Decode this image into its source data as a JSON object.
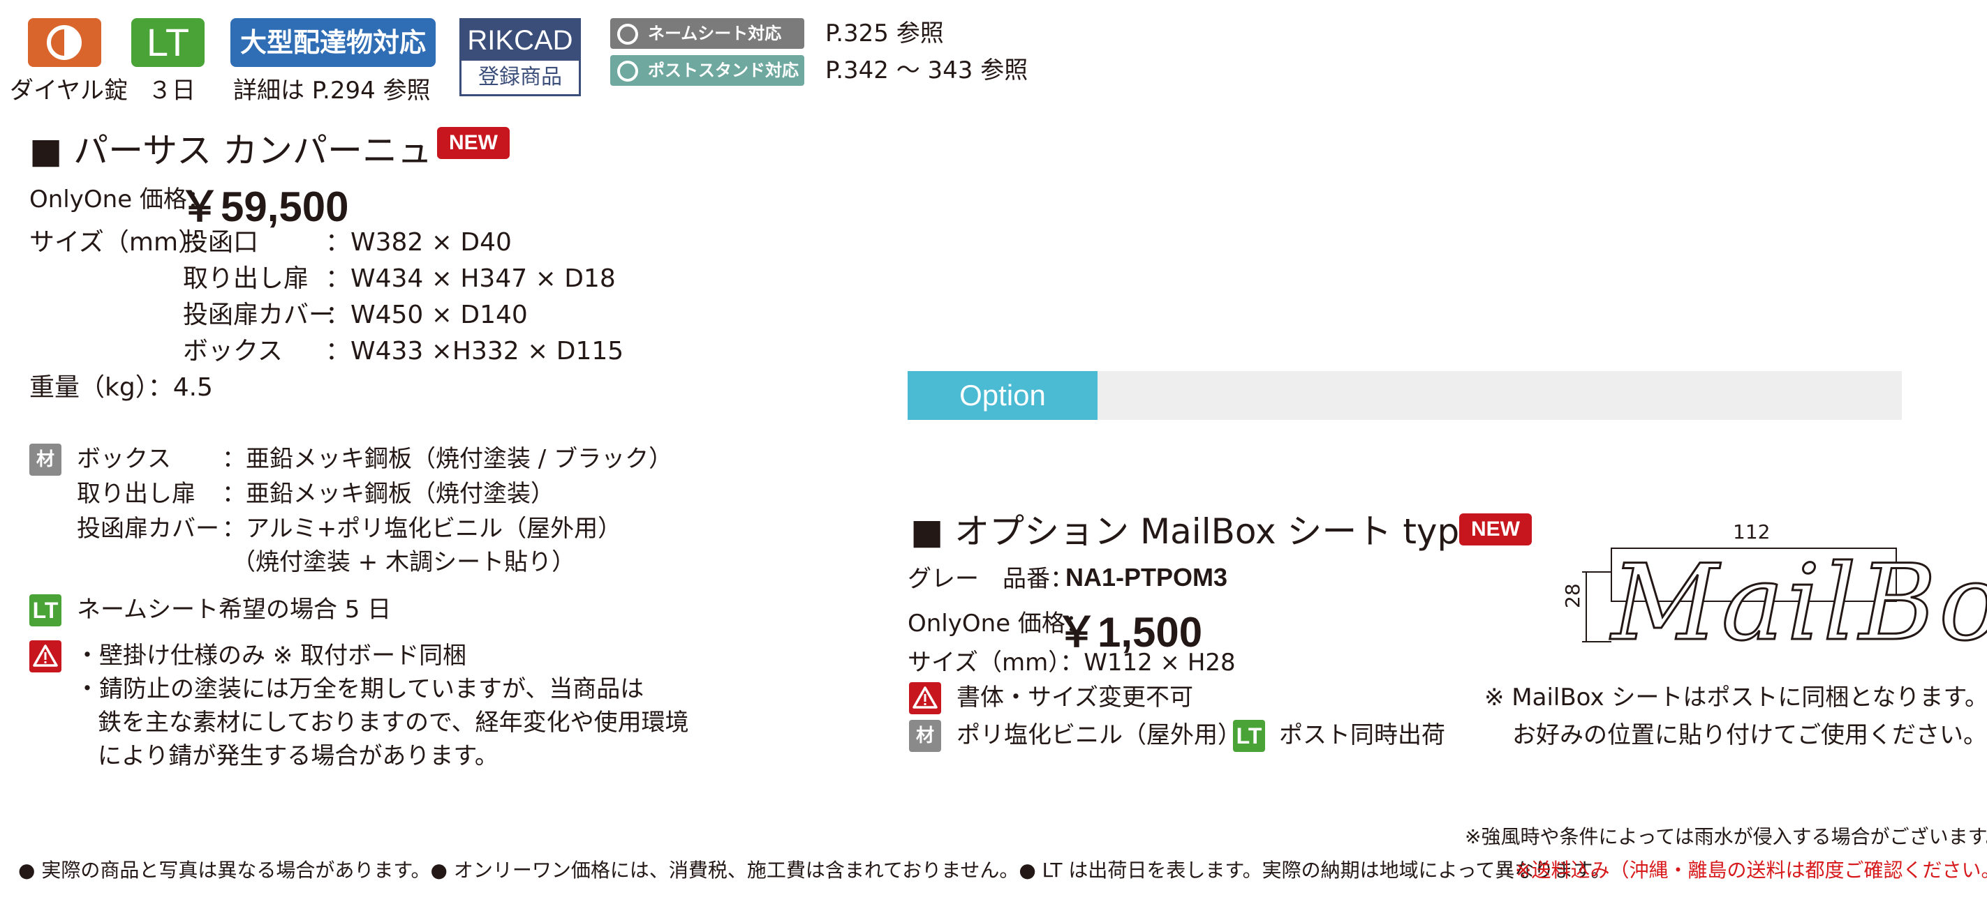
{
  "icons": {
    "dial_caption": "ダイヤル錠",
    "lt_label": "LT",
    "lt_caption": "３日",
    "large_delivery_label": "大型配達物対応",
    "large_delivery_caption": "詳細は P.294 参照",
    "rikcad_top": "RIKCAD",
    "rikcad_bottom": "登録商品"
  },
  "compat": [
    {
      "label": "ネームシート対応",
      "ref": "P.325 参照",
      "color": "#7b7b7b"
    },
    {
      "label": "ポストスタンド対応",
      "ref": "P.342 〜 343 参照",
      "color": "#6fa89e"
    }
  ],
  "product": {
    "title": "■ パーサス カンパーニュ",
    "new_badge": "NEW",
    "price_label": "OnlyOne 価格：",
    "price": "￥59,500",
    "size_label": "サイズ（mm）：",
    "sizes": [
      {
        "part": "投函口",
        "value": "：W382 × D40"
      },
      {
        "part": "取り出し扉",
        "value": "：W434 × H347 × D18"
      },
      {
        "part": "投函扉カバー",
        "value": "：W450 × D140"
      },
      {
        "part": "ボックス",
        "value": "：W433 ×H332 × D115"
      }
    ],
    "weight": "重量（kg）：4.5",
    "material_icon": "材質",
    "materials": [
      {
        "part": "ボックス",
        "value": "：亜鉛メッキ鋼板（焼付塗装 / ブラック）"
      },
      {
        "part": "取り出し扉",
        "value": "：亜鉛メッキ鋼板（焼付塗装）"
      },
      {
        "part": "投函扉カバー",
        "value": "：アルミ+ポリ塩化ビニル（屋外用）"
      },
      {
        "part": "",
        "value": "（焼付塗装 + 木調シート貼り）"
      }
    ],
    "lt_icon": "LT",
    "lt_note": "ネームシート希望の場合 5 日",
    "warnings": [
      "・壁掛け仕様のみ ※ 取付ボード同梱",
      "・錆防止の塗装には万全を期していますが、当商品は",
      "鉄を主な素材にしておりますので、経年変化や使用環境",
      "により錆が発生する場合があります。"
    ]
  },
  "option_bar": {
    "label": "Option",
    "accent": "#4bbad3"
  },
  "option": {
    "title": "■ オプション MailBox シート type3",
    "new_badge": "NEW",
    "color_label": "グレー　品番：",
    "code": "NA1-PTPOM3",
    "price_label": "OnlyOne 価格：",
    "price": "￥1,500",
    "size": "サイズ（mm）：W112 × H28",
    "warning": "書体・サイズ変更不可",
    "material_icon": "材質",
    "material": "ポリ塩化ビニル（屋外用）",
    "lt_icon": "LT",
    "lt_note": "ポスト同時出荷",
    "dim_width": "112",
    "dim_height": "28",
    "sheet_text": "MailBox",
    "notes": [
      "※ MailBox シートはポストに同梱となります。",
      "お好みの位置に貼り付けてご使用ください。"
    ]
  },
  "footer": {
    "rain_note": "※強風時や条件によっては雨水が侵入する場合がございます。",
    "notes": "● 実際の商品と写真は異なる場合があります。● オンリーワン価格には、消費税、施工費は含まれておりません。● LT は出荷日を表します。実際の納期は地域によって異なります。",
    "shipping": "※送料込み（沖縄・離島の送料は都度ご確認ください。）",
    "shipping_color": "#d7191c"
  }
}
